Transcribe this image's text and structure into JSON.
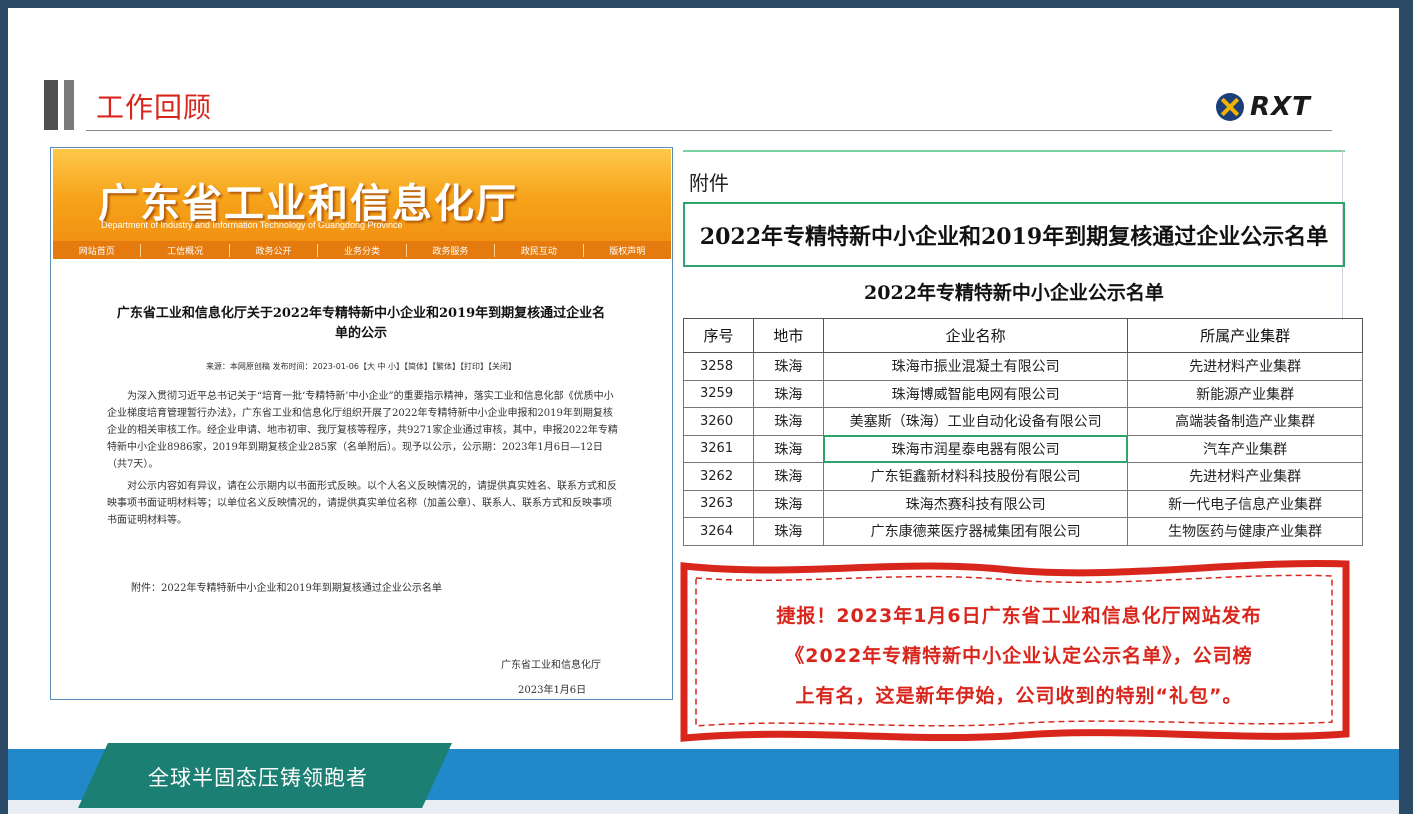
{
  "header": {
    "title": "工作回顾",
    "logo_text": "RXT"
  },
  "left_doc": {
    "banner_title": "广东省工业和信息化厅",
    "banner_subtitle": "Department of Industry and Information Technology of Guangdong Province",
    "nav": [
      "网站首页",
      "工信概况",
      "政务公开",
      "业务分类",
      "政务服务",
      "政民互动",
      "版权声明"
    ],
    "heading": "广东省工业和信息化厅关于2022年专精特新中小企业和2019年到期复核通过企业名单的公示",
    "meta": "来源：本网原创稿 发布时间：2023-01-06【大 中 小】【简体】【繁体】【打印】【关闭】",
    "paragraphs": [
      "为深入贯彻习近平总书记关于“培育一批‘专精特新’中小企业”的重要指示精神，落实工业和信息化部《优质中小企业梯度培育管理暂行办法》，广东省工业和信息化厅组织开展了2022年专精特新中小企业申报和2019年到期复核企业的相关审核工作。经企业申请、地市初审、我厅复核等程序，共9271家企业通过审核，其中，申报2022年专精特新中小企业8986家，2019年到期复核企业285家（名单附后）。现予以公示，公示期：2023年1月6日—12日（共7天）。",
      "对公示内容如有异议，请在公示期内以书面形式反映。以个人名义反映情况的，请提供真实姓名、联系方式和反映事项书面证明材料等；以单位名义反映情况的，请提供真实单位名称（加盖公章）、联系人、联系方式和反映事项书面证明材料等。"
    ],
    "attachment": "附件：2022年专精特新中小企业和2019年到期复核通过企业公示名单",
    "signature": "广东省工业和信息化厅",
    "date": "2023年1月6日"
  },
  "right_doc": {
    "attachment_label": "附件",
    "main_title": "2022年专精特新中小企业和2019年到期复核通过企业公示名单",
    "subtitle": "2022年专精特新中小企业公示名单",
    "columns": [
      "序号",
      "地市",
      "企业名称",
      "所属产业集群"
    ],
    "rows": [
      {
        "no": "3258",
        "city": "珠海",
        "company": "珠海市振业混凝土有限公司",
        "cluster": "先进材料产业集群"
      },
      {
        "no": "3259",
        "city": "珠海",
        "company": "珠海博威智能电网有限公司",
        "cluster": "新能源产业集群"
      },
      {
        "no": "3260",
        "city": "珠海",
        "company": "美塞斯（珠海）工业自动化设备有限公司",
        "cluster": "高端装备制造产业集群"
      },
      {
        "no": "3261",
        "city": "珠海",
        "company": "珠海市润星泰电器有限公司",
        "cluster": "汽车产业集群"
      },
      {
        "no": "3262",
        "city": "珠海",
        "company": "广东钜鑫新材料科技股份有限公司",
        "cluster": "先进材料产业集群"
      },
      {
        "no": "3263",
        "city": "珠海",
        "company": "珠海杰赛科技有限公司",
        "cluster": "新一代电子信息产业集群"
      },
      {
        "no": "3264",
        "city": "珠海",
        "company": "广东康德莱医疗器械集团有限公司",
        "cluster": "生物医药与健康产业集群"
      }
    ]
  },
  "callout": {
    "lines": [
      "捷报！2023年1月6日广东省工业和信息化厅网站发布",
      "《2022年专精特新中小企业认定公示名单》，公司榜",
      "上有名，这是新年伊始，公司收到的特别“礼包”。"
    ]
  },
  "footer": {
    "tagline": "全球半固态压铸领跑者"
  },
  "colors": {
    "frame": "#2b4a66",
    "accent_red": "#d9261c",
    "footer_blue": "#2188c9",
    "footer_teal": "#1c7f73",
    "highlight_green": "#2fa46a"
  }
}
